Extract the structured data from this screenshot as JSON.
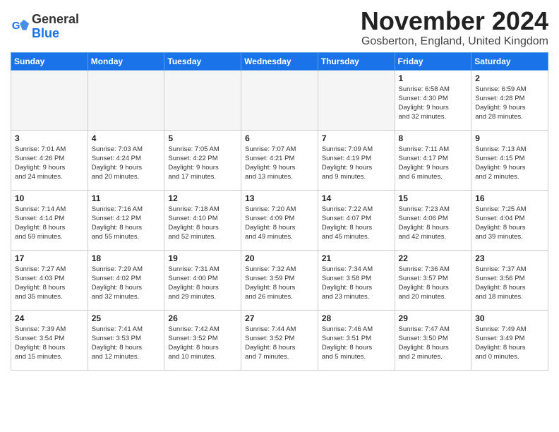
{
  "header": {
    "logo": {
      "general": "General",
      "blue": "Blue"
    },
    "title": "November 2024",
    "location": "Gosberton, England, United Kingdom"
  },
  "weekdays": [
    "Sunday",
    "Monday",
    "Tuesday",
    "Wednesday",
    "Thursday",
    "Friday",
    "Saturday"
  ],
  "weeks": [
    [
      {
        "day": "",
        "info": ""
      },
      {
        "day": "",
        "info": ""
      },
      {
        "day": "",
        "info": ""
      },
      {
        "day": "",
        "info": ""
      },
      {
        "day": "",
        "info": ""
      },
      {
        "day": "1",
        "info": "Sunrise: 6:58 AM\nSunset: 4:30 PM\nDaylight: 9 hours\nand 32 minutes."
      },
      {
        "day": "2",
        "info": "Sunrise: 6:59 AM\nSunset: 4:28 PM\nDaylight: 9 hours\nand 28 minutes."
      }
    ],
    [
      {
        "day": "3",
        "info": "Sunrise: 7:01 AM\nSunset: 4:26 PM\nDaylight: 9 hours\nand 24 minutes."
      },
      {
        "day": "4",
        "info": "Sunrise: 7:03 AM\nSunset: 4:24 PM\nDaylight: 9 hours\nand 20 minutes."
      },
      {
        "day": "5",
        "info": "Sunrise: 7:05 AM\nSunset: 4:22 PM\nDaylight: 9 hours\nand 17 minutes."
      },
      {
        "day": "6",
        "info": "Sunrise: 7:07 AM\nSunset: 4:21 PM\nDaylight: 9 hours\nand 13 minutes."
      },
      {
        "day": "7",
        "info": "Sunrise: 7:09 AM\nSunset: 4:19 PM\nDaylight: 9 hours\nand 9 minutes."
      },
      {
        "day": "8",
        "info": "Sunrise: 7:11 AM\nSunset: 4:17 PM\nDaylight: 9 hours\nand 6 minutes."
      },
      {
        "day": "9",
        "info": "Sunrise: 7:13 AM\nSunset: 4:15 PM\nDaylight: 9 hours\nand 2 minutes."
      }
    ],
    [
      {
        "day": "10",
        "info": "Sunrise: 7:14 AM\nSunset: 4:14 PM\nDaylight: 8 hours\nand 59 minutes."
      },
      {
        "day": "11",
        "info": "Sunrise: 7:16 AM\nSunset: 4:12 PM\nDaylight: 8 hours\nand 55 minutes."
      },
      {
        "day": "12",
        "info": "Sunrise: 7:18 AM\nSunset: 4:10 PM\nDaylight: 8 hours\nand 52 minutes."
      },
      {
        "day": "13",
        "info": "Sunrise: 7:20 AM\nSunset: 4:09 PM\nDaylight: 8 hours\nand 49 minutes."
      },
      {
        "day": "14",
        "info": "Sunrise: 7:22 AM\nSunset: 4:07 PM\nDaylight: 8 hours\nand 45 minutes."
      },
      {
        "day": "15",
        "info": "Sunrise: 7:23 AM\nSunset: 4:06 PM\nDaylight: 8 hours\nand 42 minutes."
      },
      {
        "day": "16",
        "info": "Sunrise: 7:25 AM\nSunset: 4:04 PM\nDaylight: 8 hours\nand 39 minutes."
      }
    ],
    [
      {
        "day": "17",
        "info": "Sunrise: 7:27 AM\nSunset: 4:03 PM\nDaylight: 8 hours\nand 35 minutes."
      },
      {
        "day": "18",
        "info": "Sunrise: 7:29 AM\nSunset: 4:02 PM\nDaylight: 8 hours\nand 32 minutes."
      },
      {
        "day": "19",
        "info": "Sunrise: 7:31 AM\nSunset: 4:00 PM\nDaylight: 8 hours\nand 29 minutes."
      },
      {
        "day": "20",
        "info": "Sunrise: 7:32 AM\nSunset: 3:59 PM\nDaylight: 8 hours\nand 26 minutes."
      },
      {
        "day": "21",
        "info": "Sunrise: 7:34 AM\nSunset: 3:58 PM\nDaylight: 8 hours\nand 23 minutes."
      },
      {
        "day": "22",
        "info": "Sunrise: 7:36 AM\nSunset: 3:57 PM\nDaylight: 8 hours\nand 20 minutes."
      },
      {
        "day": "23",
        "info": "Sunrise: 7:37 AM\nSunset: 3:56 PM\nDaylight: 8 hours\nand 18 minutes."
      }
    ],
    [
      {
        "day": "24",
        "info": "Sunrise: 7:39 AM\nSunset: 3:54 PM\nDaylight: 8 hours\nand 15 minutes."
      },
      {
        "day": "25",
        "info": "Sunrise: 7:41 AM\nSunset: 3:53 PM\nDaylight: 8 hours\nand 12 minutes."
      },
      {
        "day": "26",
        "info": "Sunrise: 7:42 AM\nSunset: 3:52 PM\nDaylight: 8 hours\nand 10 minutes."
      },
      {
        "day": "27",
        "info": "Sunrise: 7:44 AM\nSunset: 3:52 PM\nDaylight: 8 hours\nand 7 minutes."
      },
      {
        "day": "28",
        "info": "Sunrise: 7:46 AM\nSunset: 3:51 PM\nDaylight: 8 hours\nand 5 minutes."
      },
      {
        "day": "29",
        "info": "Sunrise: 7:47 AM\nSunset: 3:50 PM\nDaylight: 8 hours\nand 2 minutes."
      },
      {
        "day": "30",
        "info": "Sunrise: 7:49 AM\nSunset: 3:49 PM\nDaylight: 8 hours\nand 0 minutes."
      }
    ]
  ]
}
